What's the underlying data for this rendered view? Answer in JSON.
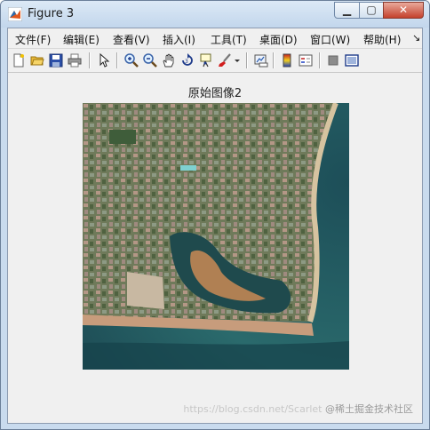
{
  "window": {
    "title": "Figure 3",
    "controls": [
      "minimize",
      "maximize",
      "close"
    ]
  },
  "menu": [
    {
      "label": "文件(F)"
    },
    {
      "label": "编辑(E)"
    },
    {
      "label": "查看(V)"
    },
    {
      "label": "插入(I)"
    },
    {
      "label": "工具(T)"
    },
    {
      "label": "桌面(D)"
    },
    {
      "label": "窗口(W)"
    },
    {
      "label": "帮助(H)"
    }
  ],
  "menu_overflow": "↘",
  "toolbar": {
    "icons": [
      "new-figure-icon",
      "open-file-icon",
      "save-icon",
      "print-icon",
      "pointer-icon",
      "zoom-in-icon",
      "zoom-out-icon",
      "pan-hand-icon",
      "rotate-3d-icon",
      "data-cursor-icon",
      "brush-icon",
      "brush-dropdown-icon",
      "link-plot-icon",
      "colorbar-icon",
      "legend-icon",
      "hide-plot-tools-icon",
      "show-plot-tools-icon"
    ]
  },
  "plot": {
    "title": "原始图像2"
  },
  "colors": {
    "title_bar": "#c2d6ec",
    "client": "#f0f0f0",
    "close_button": "#c4412c"
  },
  "watermark": {
    "url": "https://blog.csdn.net/Scarlet",
    "badge": "@稀土掘金技术社区"
  }
}
